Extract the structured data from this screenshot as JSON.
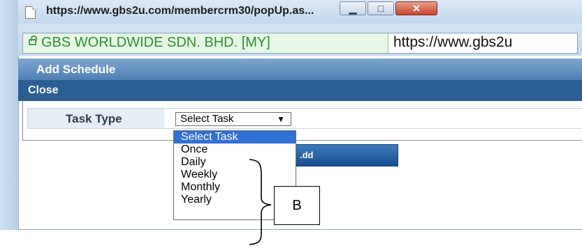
{
  "window": {
    "title": "https://www.gbs2u.com/membercrm30/popUp.as...",
    "buttons": [
      "minimize",
      "maximize",
      "close"
    ]
  },
  "address_bar": {
    "secure_identity": "GBS WORLDWIDE SDN. BHD. [MY]",
    "url": "https://www.gbs2u"
  },
  "page": {
    "header_title": "Add Schedule",
    "close_label": "Close",
    "form": {
      "task_type_label": "Task Type",
      "select_value": "Select Task",
      "options": [
        "Select Task",
        "Once",
        "Daily",
        "Weekly",
        "Monthly",
        "Yearly"
      ]
    },
    "add_button_label": ".dd"
  },
  "annotation": {
    "label": "B"
  },
  "colors": {
    "header_gradient_top": "#7fa7d0",
    "close_bar": "#2a5f93",
    "option_highlight": "#2f6fd6",
    "secure_text": "#2f8f2f"
  },
  "icons": {
    "page": "page-icon",
    "lock": "lock-icon",
    "dropdown_arrow": "triangle-down-icon"
  }
}
